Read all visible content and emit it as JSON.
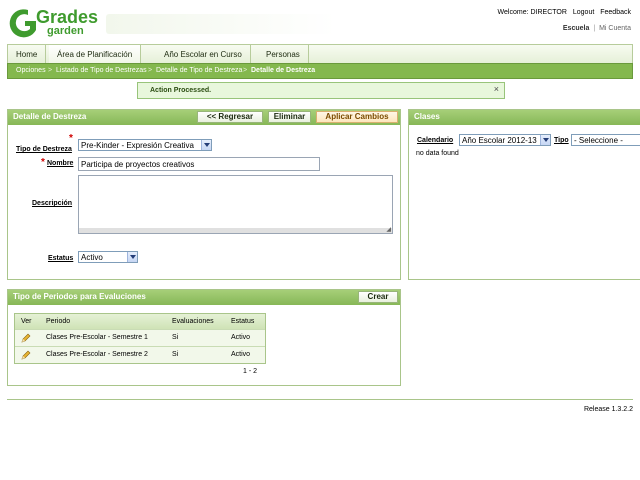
{
  "brand": {
    "line1": "Grades",
    "line2": "garden"
  },
  "top_links": {
    "welcome": "Welcome: DIRECTOR",
    "logout": "Logout",
    "feedback": "Feedback"
  },
  "school_links": {
    "school": "Escuela",
    "separator": "|",
    "account": "Mi Cuenta"
  },
  "nav": {
    "tabs": [
      "Home",
      "Área de Planificación",
      "Año Escolar en Curso",
      "Personas"
    ],
    "active_index": 1
  },
  "breadcrumb": {
    "items": [
      "Opciones",
      "Listado de Tipo de Destrezas",
      "Detalle de Tipo de Destreza",
      "Detalle de Destreza"
    ],
    "separator": ">"
  },
  "message": {
    "text": "Action Processed.",
    "close": "×"
  },
  "detalle": {
    "title": "Detalle de Destreza",
    "buttons": {
      "back": "<< Regresar",
      "delete": "Eliminar",
      "apply": "Aplicar Cambios"
    },
    "fields": {
      "tipo_label": "Tipo de Destreza",
      "tipo_value": "Pre-Kinder - Expresión Creativa",
      "nombre_label": "Nombre",
      "nombre_value": "Participa de proyectos creativos",
      "descripcion_label": "Descripción",
      "descripcion_value": "",
      "estatus_label": "Estatus",
      "estatus_value": "Activo"
    },
    "required_mark": "*"
  },
  "clases": {
    "title": "Clases",
    "calendario_label": "Calendario",
    "calendario_value": "Año Escolar 2012-13",
    "tipo_label": "Tipo",
    "tipo_value": "- Seleccione -",
    "empty": "no data found"
  },
  "periodos": {
    "title": "Tipo de Periodos para Evaluciones",
    "create": "Crear",
    "columns": [
      "Ver",
      "Periodo",
      "Evaluaciones",
      "Estatus"
    ],
    "rows": [
      {
        "periodo": "Clases Pre-Escolar - Semestre 1",
        "evaluaciones": "Si",
        "estatus": "Activo"
      },
      {
        "periodo": "Clases Pre-Escolar - Semestre 2",
        "evaluaciones": "Si",
        "estatus": "Activo"
      }
    ],
    "pagination": "1 - 2"
  },
  "footer": {
    "release": "Release 1.3.2.2"
  },
  "colors": {
    "accent_green": "#84b84e",
    "panel_title": "#98c468",
    "required": "#d00000"
  },
  "icons": {
    "edit": "pencil-icon",
    "close": "close-icon",
    "dropdown": "chevron-down-icon"
  }
}
